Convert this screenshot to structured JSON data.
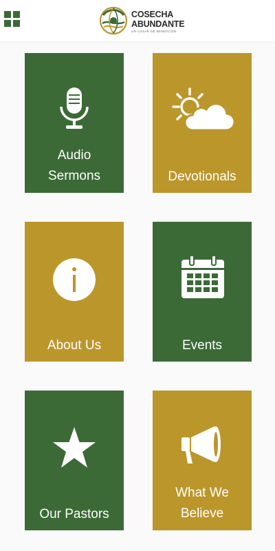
{
  "header": {
    "logo": {
      "line1": "COSECHA",
      "line2": "ABUNDANTE",
      "tagline": "UN LUGAR DE BENDICIÓN"
    },
    "menu_icon": "grid-menu-icon"
  },
  "colors": {
    "green": "#3b6a37",
    "gold": "#bb962b",
    "background": "#fafafa",
    "text_on_tile": "#ffffff"
  },
  "tiles": [
    {
      "label_line1": "Audio",
      "label_line2": "Sermons",
      "icon": "microphone-icon",
      "color": "green"
    },
    {
      "label_line1": "Devotionals",
      "icon": "sun-cloud-icon",
      "color": "gold"
    },
    {
      "label_line1": "About Us",
      "icon": "info-icon",
      "color": "gold"
    },
    {
      "label_line1": "Events",
      "icon": "calendar-icon",
      "color": "green"
    },
    {
      "label_line1": "Our Pastors",
      "icon": "star-icon",
      "color": "green"
    },
    {
      "label_line1": "What We",
      "label_line2": "Believe",
      "icon": "megaphone-icon",
      "color": "gold"
    }
  ]
}
